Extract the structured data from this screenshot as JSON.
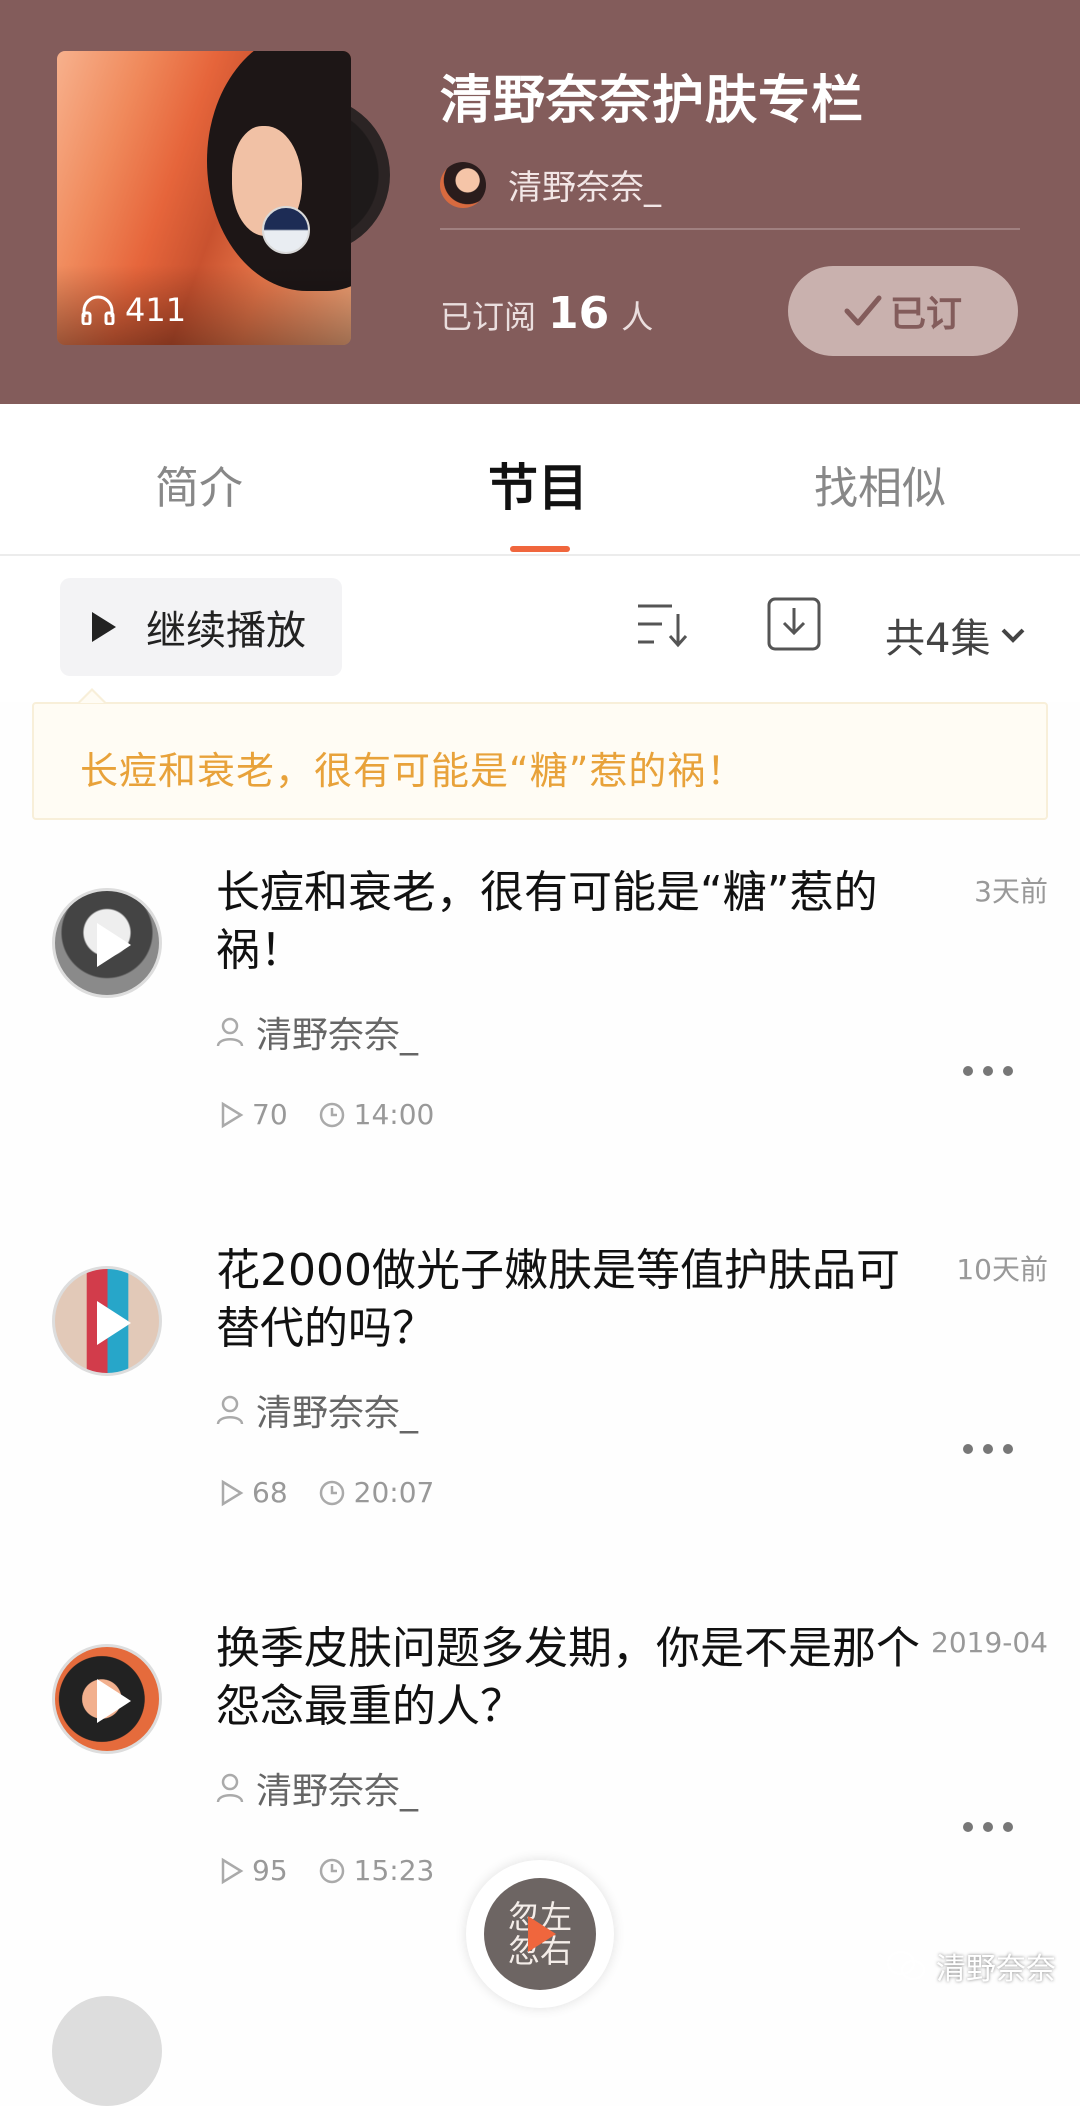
{
  "header": {
    "album_title": "清野奈奈护肤专栏",
    "author_name": "清野奈奈_",
    "play_count": "411",
    "subscribed_prefix": "已订阅",
    "subscribed_count": "16",
    "subscribed_suffix": "人",
    "subscribe_button": "已订"
  },
  "tabs": [
    {
      "label": "简介",
      "active": false
    },
    {
      "label": "节目",
      "active": true
    },
    {
      "label": "找相似",
      "active": false
    }
  ],
  "toolbar": {
    "continue_label": "继续播放",
    "total_label": "共4集"
  },
  "tip": {
    "text": "长痘和衰老，很有可能是“糖”惹的祸！"
  },
  "episodes": [
    {
      "title": "长痘和衰老，很有可能是“糖”惹的祸！",
      "date": "3天前",
      "author": "清野奈奈_",
      "plays": "70",
      "duration": "14:00"
    },
    {
      "title": "花2000做光子嫩肤是等值护肤品可替代的吗？",
      "date": "10天前",
      "author": "清野奈奈_",
      "plays": "68",
      "duration": "20:07"
    },
    {
      "title": "换季皮肤问题多发期，你是不是那个怨念最重的人？",
      "date": "2019-04",
      "author": "清野奈奈_",
      "plays": "95",
      "duration": "15:23"
    }
  ],
  "float_player": {
    "line1": "忽左",
    "line2": "忽右"
  },
  "watermark": {
    "text": "清野奈奈"
  },
  "colors": {
    "header_bg": "#835c5b",
    "accent": "#f0663d",
    "tip_text": "#e8a23a"
  }
}
